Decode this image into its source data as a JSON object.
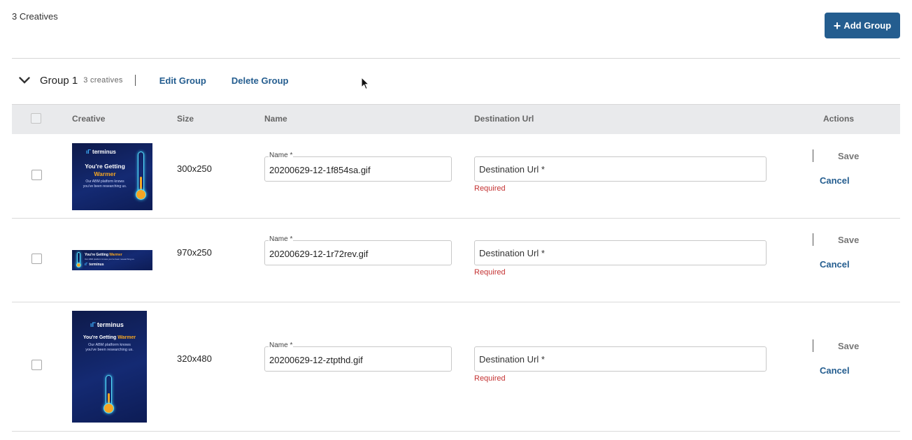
{
  "header": {
    "count_label": "3 Creatives",
    "add_group_label": "Add Group",
    "add_group_icon": "plus-icon"
  },
  "group": {
    "title": "Group 1",
    "count_label": "3 creatives",
    "edit_label": "Edit Group",
    "delete_label": "Delete Group",
    "expand_icon": "chevron-down-icon"
  },
  "table": {
    "columns": [
      "Creative",
      "Size",
      "Name",
      "Destination Url",
      "Actions"
    ],
    "rows": [
      {
        "size": "300x250",
        "name_label": "Name *",
        "name_value": "20200629-12-1f854sa.gif",
        "url_placeholder": "Destination Url *",
        "error": "Required",
        "save_label": "Save",
        "cancel_label": "Cancel",
        "thumb": {
          "brand": "terminus",
          "headline": "You're Getting",
          "headline_hot": "Warmer",
          "sub1": "Our ABM platform knows",
          "sub2": "you've been researching us."
        }
      },
      {
        "size": "970x250",
        "name_label": "Name *",
        "name_value": "20200629-12-1r72rev.gif",
        "url_placeholder": "Destination Url *",
        "error": "Required",
        "save_label": "Save",
        "cancel_label": "Cancel",
        "thumb": {
          "brand": "terminus",
          "headline": "You're Getting",
          "headline_hot": "Warmer",
          "sub1": "Our ABM platform knows you've been researching us."
        }
      },
      {
        "size": "320x480",
        "name_label": "Name *",
        "name_value": "20200629-12-ztpthd.gif",
        "url_placeholder": "Destination Url *",
        "error": "Required",
        "save_label": "Save",
        "cancel_label": "Cancel",
        "thumb": {
          "brand": "terminus",
          "headline": "You're Getting",
          "headline_hot": "Warmer",
          "sub1": "Our ABM platform knows",
          "sub2": "you've been researching us."
        }
      }
    ]
  },
  "colors": {
    "primary": "#245d8f",
    "error": "#c43232",
    "header_bg": "#e9eaec",
    "accent": "#f5a623"
  }
}
